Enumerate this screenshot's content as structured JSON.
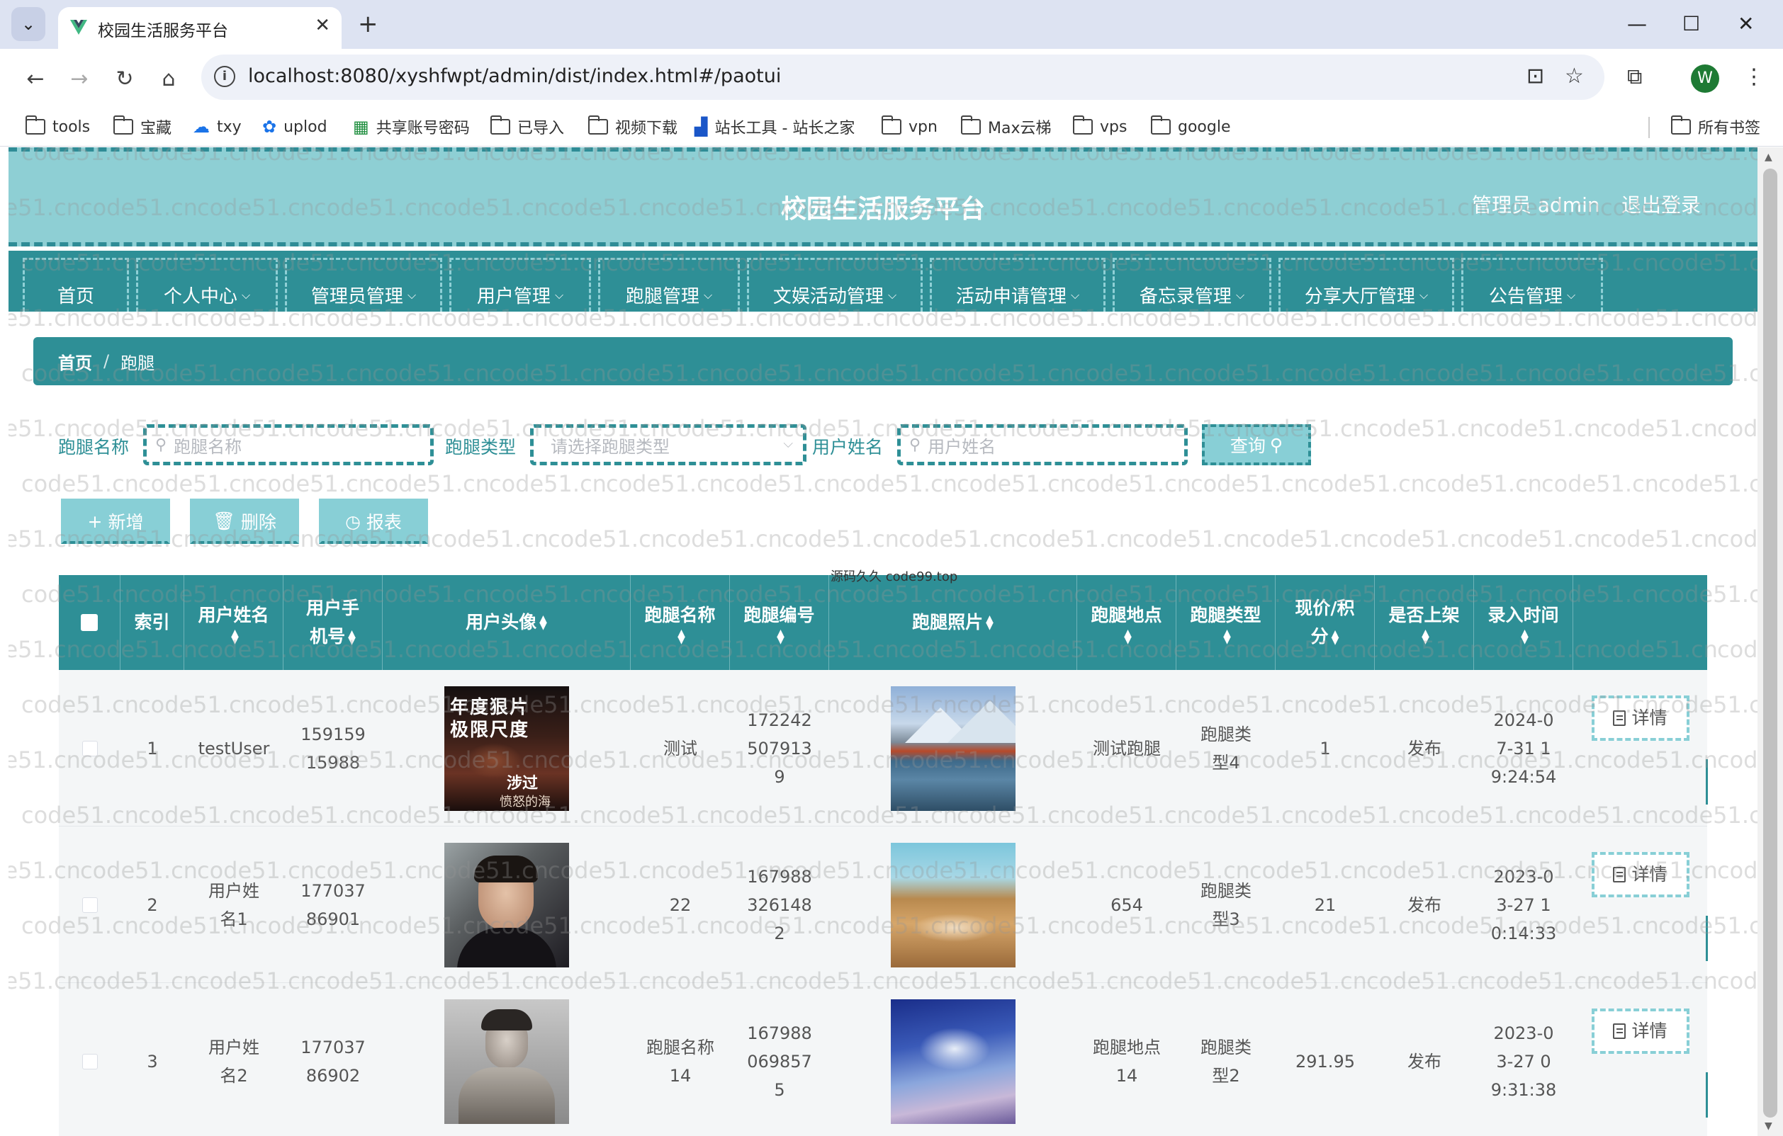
{
  "browser": {
    "tab_title": "校园生活服务平台",
    "url": "localhost:8080/xyshfwpt/admin/dist/index.html#/paotui",
    "bookmarks": [
      "tools",
      "宝藏",
      "txy",
      "uplod",
      "共享账号密码",
      "已导入",
      "视频下载",
      "站长工具 - 站长之家",
      "vpn",
      "Max云梯",
      "vps",
      "google"
    ],
    "all_bookmarks": "所有书签",
    "profile_initial": "W"
  },
  "header": {
    "title": "校园生活服务平台",
    "admin_label": "管理员 admin",
    "logout": "退出登录"
  },
  "nav": [
    "首页",
    "个人中心",
    "管理员管理",
    "用户管理",
    "跑腿管理",
    "文娱活动管理",
    "活动申请管理",
    "备忘录管理",
    "分享大厅管理",
    "公告管理"
  ],
  "breadcrumb": {
    "home": "首页",
    "separator": "/",
    "current": "跑腿"
  },
  "search": {
    "name_label": "跑腿名称",
    "name_placeholder": "跑腿名称",
    "type_label": "跑腿类型",
    "type_placeholder": "请选择跑腿类型",
    "user_label": "用户姓名",
    "user_placeholder": "用户姓名",
    "query_button": "查询"
  },
  "actions": {
    "add": "新增",
    "delete": "删除",
    "report": "报表"
  },
  "overlay_text": "源码久久 code99.top",
  "watermark": "code51.cn",
  "table": {
    "headers": [
      "索引",
      "用户姓名",
      "用户手机号",
      "用户头像",
      "跑腿名称",
      "跑腿编号",
      "跑腿照片",
      "跑腿地点",
      "跑腿类型",
      "现价/积分",
      "是否上架",
      "录入时间"
    ],
    "detail_button": "详情",
    "rows": [
      {
        "index": "1",
        "user_name": "testUser",
        "phone": "15915915988",
        "avatar_text": [
          "年度狠片",
          "极限尺度",
          "涉过",
          "愤怒的海"
        ],
        "name": "测试",
        "code": "1722425079139",
        "place": "测试跑腿",
        "type": "跑腿类型4",
        "price": "1",
        "status": "发布",
        "time": "2024-07-31 19:24:54"
      },
      {
        "index": "2",
        "user_name": "用户姓名1",
        "phone": "17703786901",
        "avatar_text": [],
        "name": "22",
        "code": "1679883261482",
        "place": "654",
        "type": "跑腿类型3",
        "price": "21",
        "status": "发布",
        "time": "2023-03-27 10:14:33"
      },
      {
        "index": "3",
        "user_name": "用户姓名2",
        "phone": "17703786902",
        "avatar_text": [],
        "name": "跑腿名称14",
        "code": "1679880698575",
        "place": "跑腿地点14",
        "type": "跑腿类型2",
        "price": "291.95",
        "status": "发布",
        "time": "2023-03-27 09:31:38"
      }
    ]
  },
  "colors": {
    "primary": "#2e8f96",
    "light": "#88cfd6",
    "header_bg": "#8ecfd4"
  }
}
